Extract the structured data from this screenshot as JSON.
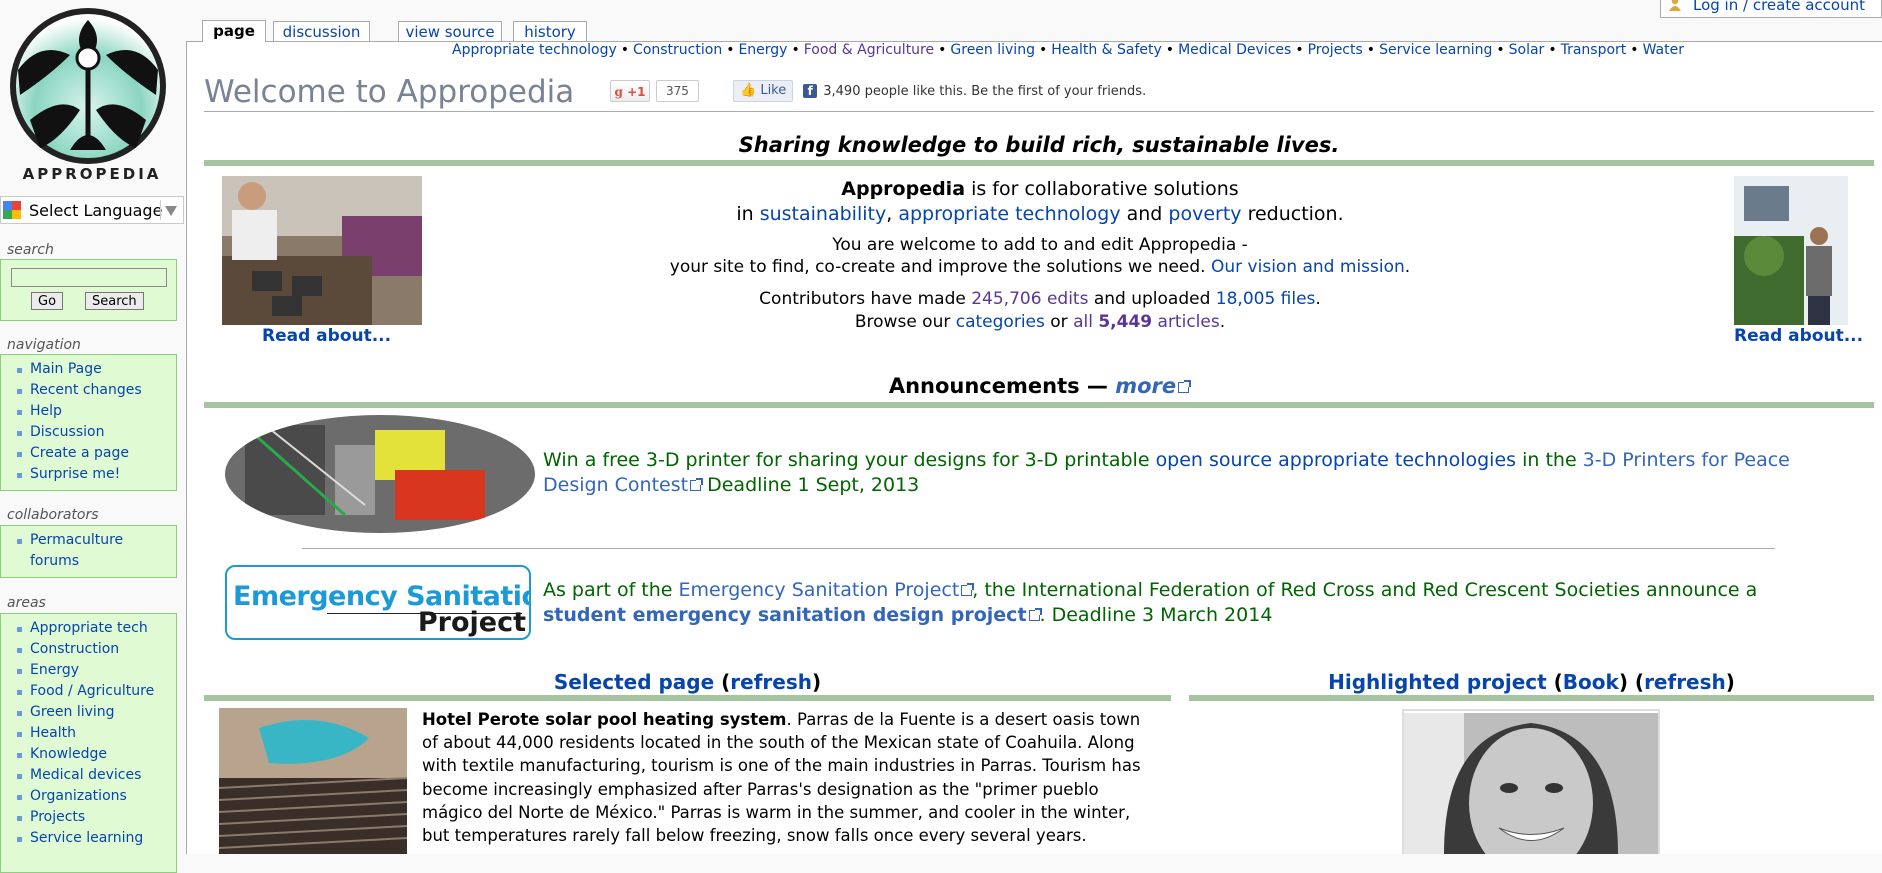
{
  "brand": {
    "logo_text": "APPROPEDIA"
  },
  "language": {
    "label": "Select Language"
  },
  "sidebar": {
    "search": {
      "heading": "search",
      "go": "Go",
      "search": "Search",
      "value": ""
    },
    "navigation": {
      "heading": "navigation",
      "items": [
        "Main Page",
        "Recent changes",
        "Help",
        "Discussion",
        "Create a page",
        "Surprise me!"
      ]
    },
    "collaborators": {
      "heading": "collaborators",
      "items": [
        "Permaculture forums"
      ]
    },
    "areas": {
      "heading": "areas",
      "items": [
        "Appropriate tech",
        "Construction",
        "Energy",
        "Food / Agriculture",
        "Green living",
        "Health",
        "Knowledge",
        "Medical devices",
        "Organizations",
        "Projects",
        "Service learning"
      ]
    }
  },
  "tabs": {
    "page": "page",
    "discussion": "discussion",
    "view_source": "view source",
    "history": "history"
  },
  "login": "Log in / create account",
  "topnav": [
    "Appropriate technology",
    "Construction",
    "Energy",
    "Food & Agriculture",
    "Green living",
    "Health & Safety",
    "Medical Devices",
    "Projects",
    "Service learning",
    "Solar",
    "Transport",
    "Water"
  ],
  "title": "Welcome to Appropedia",
  "social": {
    "gplus_label": "+1",
    "gplus_count": "375",
    "fb_like": "Like",
    "fb_text": "3,490 people like this. Be the first of your friends."
  },
  "slogan": "Sharing knowledge to build rich, sustainable lives.",
  "intro": {
    "brand": "Appropedia",
    "line1_rest": " is for collaborative solutions",
    "line2_pre": "in ",
    "link_sustainability": "sustainability",
    "comma": ", ",
    "link_approtech": "appropriate technology",
    "and": " and ",
    "link_poverty": "poverty",
    "reduction": " reduction.",
    "welcome1": "You are welcome to add to and edit Appropedia -",
    "welcome2": "your site to find, co-create and improve the solutions we need. ",
    "vision_link": "Our vision and mission",
    "period": ".",
    "contrib_pre": "Contributors have made ",
    "edits": "245,706 edits",
    "uploaded": " and uploaded ",
    "files": "18,005 files",
    "browse_pre": "Browse our ",
    "categories": "categories",
    "or": " or ",
    "all": "all ",
    "count": "5,449",
    "articles": " articles"
  },
  "read_about": "Read about...",
  "announcements": {
    "heading": "Announcements — ",
    "more": "more",
    "a1": {
      "pre": "Win a free 3-D printer for sharing your designs for 3-D printable ",
      "link1": "open source appropriate technologies",
      "mid": " in the ",
      "link2": "3-D Printers for Peace Design Contest",
      "post": " Deadline 1 Sept, 2013"
    },
    "a2": {
      "logo_line1": "Emergency Sanitation",
      "logo_line2": "Project",
      "pre": "As part of the ",
      "link1": "Emergency Sanitation Project",
      "mid": ", the International Federation of Red Cross and Red Crescent Societies announce a ",
      "link2": "student emergency sanitation design project",
      "post": ". Deadline 3 March 2014"
    }
  },
  "selected": {
    "heading": "Selected page",
    "refresh": "refresh",
    "title": "Hotel Perote solar pool heating system",
    "body": ". Parras de la Fuente is a desert oasis town of about 44,000 residents located in the south of the Mexican state of Coahuila. Along with textile manufacturing, tourism is one of the main industries in Parras. Tourism has become increasingly emphasized after Parras's designation as the \"primer pueblo mágico del Norte de México.\" Parras is warm in the summer, and cooler in the winter, but temperatures rarely fall below freezing, snow falls once every several years."
  },
  "highlighted": {
    "heading": "Highlighted project",
    "book": "Book",
    "refresh": "refresh"
  },
  "colors": {
    "green_rule": "#a7c4a1",
    "portlet_bg": "#e0fbd3",
    "link": "#0645ad",
    "announcement": "#006400"
  }
}
